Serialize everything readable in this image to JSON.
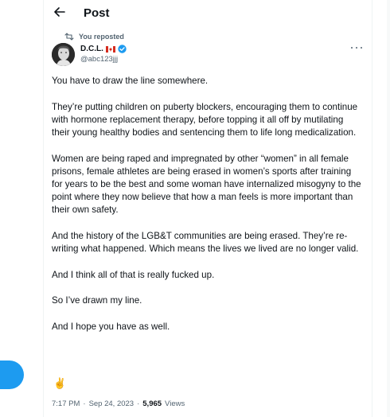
{
  "header": {
    "title": "Post"
  },
  "repost": {
    "label": "You reposted"
  },
  "author": {
    "name": "D.C.L.",
    "handle": "@abc123jjj"
  },
  "tweet": {
    "paragraphs": [
      "You have to draw the line somewhere.",
      "They’re putting children on puberty blockers, encouraging them to continue with hormone replacement therapy, before topping it all off by mutilating their young healthy bodies and sentencing them to life long medicalization.",
      "Women are being raped and impregnated by other “women” in all female prisons, female athletes are being erased in women’s sports after training for years to be the best and some woman have internalized misogyny to the point where they now believe that how a man feels is more important than their own safety.",
      "And the history of the LGB&T communities are being erased. They’re re-writing what happened. Which means the lives we lived are no longer valid.",
      "And I think all of that is really fucked up.",
      "So I’ve drawn my line.",
      "And I hope you have as well."
    ],
    "emoji": "✌️"
  },
  "meta": {
    "time": "7:17 PM",
    "separator1": "·",
    "date": "Sep 24, 2023",
    "separator2": "·",
    "views_count": "5,965",
    "views_label": "Views"
  },
  "icons": {
    "back": "back-arrow-icon",
    "repost": "repost-icon",
    "flag": "canada-flag-icon",
    "verified": "verified-badge-icon",
    "more": "more-options-icon"
  },
  "colors": {
    "accent": "#1d9bf0",
    "text": "#0f1419",
    "secondary": "#536471",
    "border": "#eff3f4",
    "flag_red": "#d52b1e"
  }
}
